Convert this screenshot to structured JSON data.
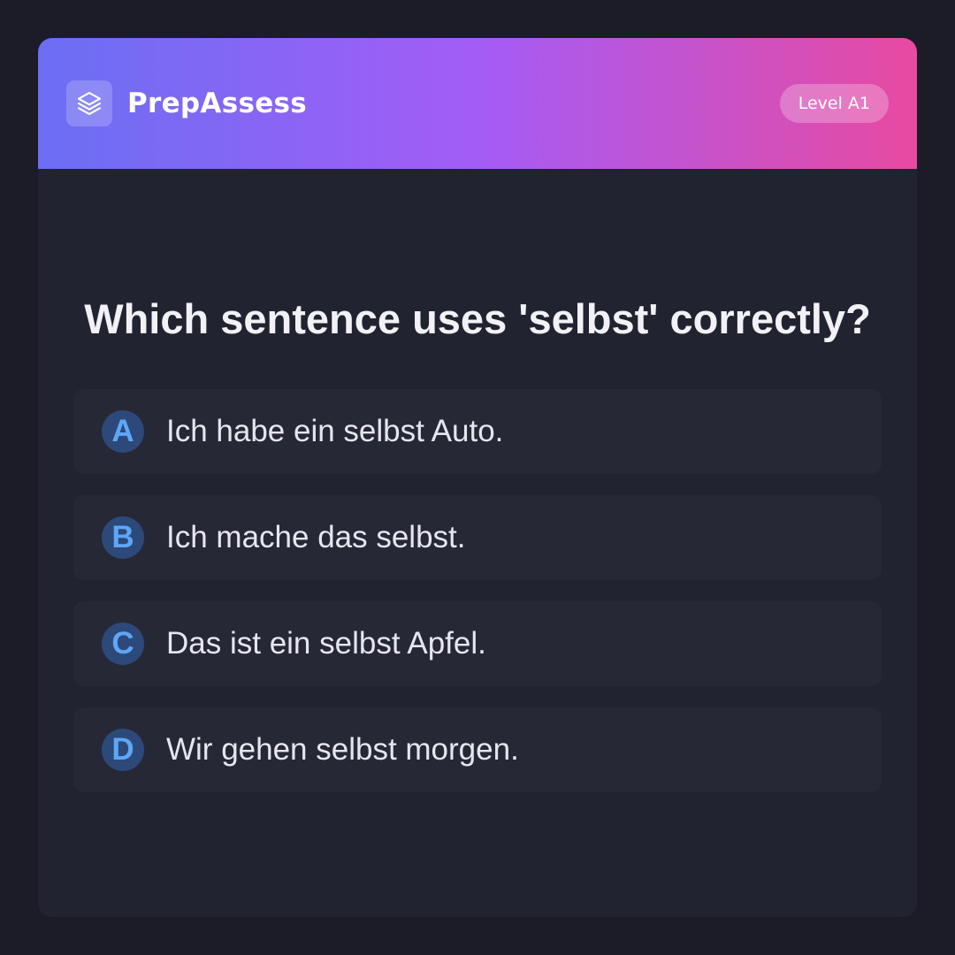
{
  "header": {
    "brand": "PrepAssess",
    "logo_icon": "layers-icon",
    "level_badge": "Level A1"
  },
  "question": {
    "text": "Which sentence uses 'selbst' correctly?"
  },
  "options": [
    {
      "letter": "A",
      "text": "Ich habe ein selbst Auto."
    },
    {
      "letter": "B",
      "text": "Ich mache das selbst."
    },
    {
      "letter": "C",
      "text": "Das ist ein selbst Apfel."
    },
    {
      "letter": "D",
      "text": "Wir gehen selbst morgen."
    }
  ],
  "colors": {
    "page_background": "#1b1c27",
    "card_background": "#212331",
    "option_background": "#272836",
    "header_gradient_start": "#6a6ff3",
    "header_gradient_mid": "#a45cf7",
    "header_gradient_end": "#e84aa1",
    "letter_circle": "#2c4979",
    "letter_text": "#5ea6f7"
  }
}
